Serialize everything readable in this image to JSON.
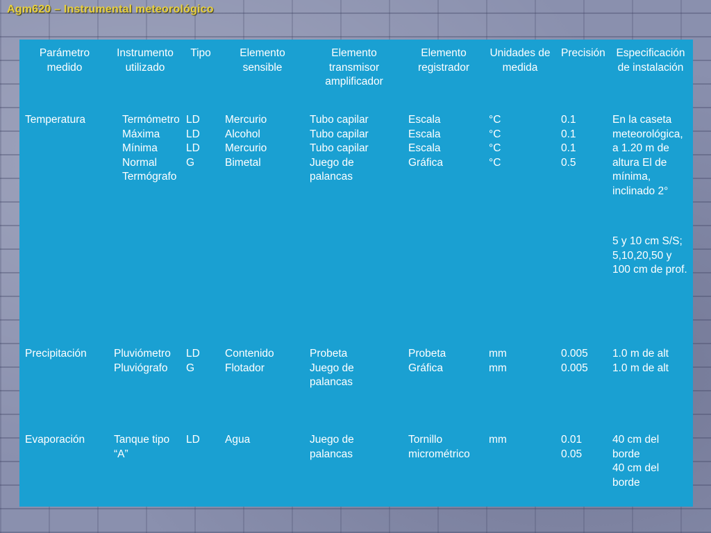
{
  "title": "Agm620 – Instrumental meteorológico",
  "colors": {
    "table_bg": "#1aa0d2",
    "title": "#e8d040",
    "text": "#ffffff"
  },
  "headers": [
    "Parámetro medido",
    "Instrumento utilizado",
    "Tipo",
    "Elemento sensible",
    "Elemento transmisor amplificador",
    "Elemento registrador",
    "Unidades de medida",
    "Precisión",
    "Especificación de instalación"
  ],
  "rows": [
    {
      "parametro": "Temperatura",
      "instrumento": [
        "Termómetro",
        "Máxima",
        "Mínima",
        "Normal",
        "Termógrafo"
      ],
      "tipo": [
        "LD",
        "LD",
        "LD",
        "G"
      ],
      "sensible": [
        "Mercurio",
        "Alcohol",
        "Mercurio",
        "Bimetal"
      ],
      "transmisor": [
        "Tubo capilar",
        "Tubo capilar",
        "Tubo capilar",
        "Juego de palancas"
      ],
      "registrador": [
        "Escala",
        "Escala",
        "Escala",
        "Gráfica"
      ],
      "unidades": [
        "°C",
        "°C",
        "°C",
        "°C"
      ],
      "precision": [
        "0.1",
        "0.1",
        "0.1",
        "0.5"
      ],
      "especificacion": [
        "En la caseta meteorológica, a 1.20 m de altura El de mínima, inclinado 2°",
        "5 y 10 cm S/S; 5,10,20,50 y 100 cm de prof."
      ]
    },
    {
      "parametro": "Precipitación",
      "instrumento": [
        "Pluviómetro",
        "Pluviógrafo"
      ],
      "tipo": [
        "LD",
        "G"
      ],
      "sensible": [
        "Contenido",
        "Flotador"
      ],
      "transmisor": [
        "Probeta",
        "Juego de palancas"
      ],
      "registrador": [
        "Probeta",
        "Gráfica"
      ],
      "unidades": [
        "mm",
        "mm"
      ],
      "precision": [
        "0.005",
        "0.005"
      ],
      "especificacion": [
        "1.0 m de alt",
        "1.0 m de alt"
      ]
    },
    {
      "parametro": "Evaporación",
      "instrumento": [
        "Tanque tipo “A”"
      ],
      "tipo": [
        "LD"
      ],
      "sensible": [
        "Agua"
      ],
      "transmisor": [
        "Juego de palancas"
      ],
      "registrador": [
        "Tornillo micrométrico"
      ],
      "unidades": [
        "mm"
      ],
      "precision": [
        "0.01",
        "0.05"
      ],
      "especificacion": [
        "40 cm del borde",
        "40 cm del borde"
      ]
    }
  ]
}
